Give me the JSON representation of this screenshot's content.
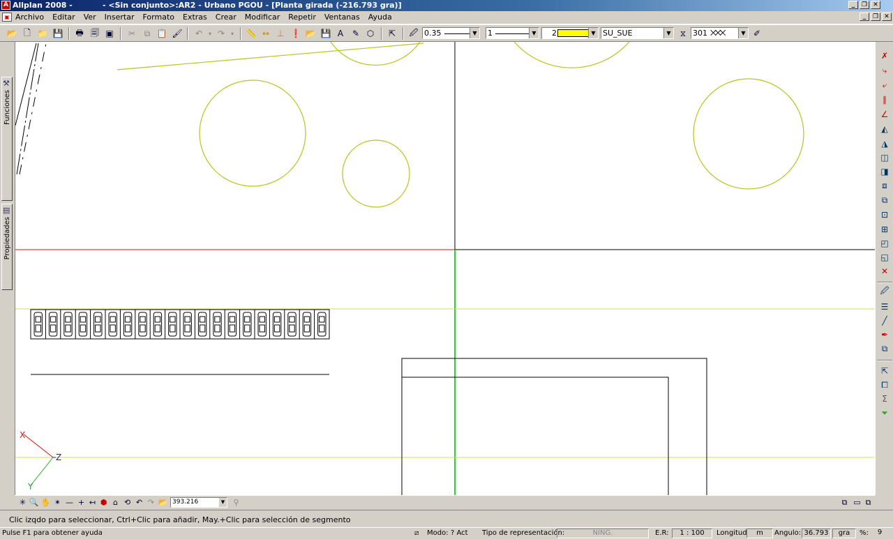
{
  "window": {
    "app_name": "Allplan 2008 -",
    "document_title": "- <Sin conjunto>:AR2 - Urbano PGOU - [Planta girada (-216.793 gra)]"
  },
  "menu": [
    "Archivo",
    "Editar",
    "Ver",
    "Insertar",
    "Formato",
    "Extras",
    "Crear",
    "Modificar",
    "Repetir",
    "Ventanas",
    "Ayuda"
  ],
  "toolbar": {
    "pen_thickness": "0.35",
    "line_type": "1",
    "color_number": "2",
    "color_swatch": "#ffff00",
    "layer": "SU_SUE",
    "hatch_number": "301"
  },
  "left_tabs": {
    "functions": "Funciones",
    "properties": "Propiedades"
  },
  "canvas": {
    "axis_labels": {
      "x": "X",
      "y": "Y",
      "z": "Z"
    },
    "colors": {
      "circles": "#b9c41a",
      "guide_line": "#d6dc5a",
      "crosshair_h_left": "#e01010",
      "crosshair_v_lower": "#22dd22",
      "lines": "#000000"
    }
  },
  "navbar": {
    "zoom_value": "393.216"
  },
  "prompt": "Clic izqdo para seleccionar, Ctrl+Clic para añadir, May.+Clic para selección de segmento",
  "status": {
    "help": "Pulse F1 para obtener ayuda",
    "mode_label": "Modo:",
    "mode_value": "? Act",
    "repr_label": "Tipo de representación:",
    "repr_value": "NING.",
    "scale_label": "E.R:",
    "scale_value": "1 : 100",
    "length_label": "Longitud",
    "length_unit": "m",
    "angle_label": "Angulo:",
    "angle_value": "36.793",
    "angle_unit": "gra",
    "percent_label": "%:",
    "percent_value": "9"
  }
}
